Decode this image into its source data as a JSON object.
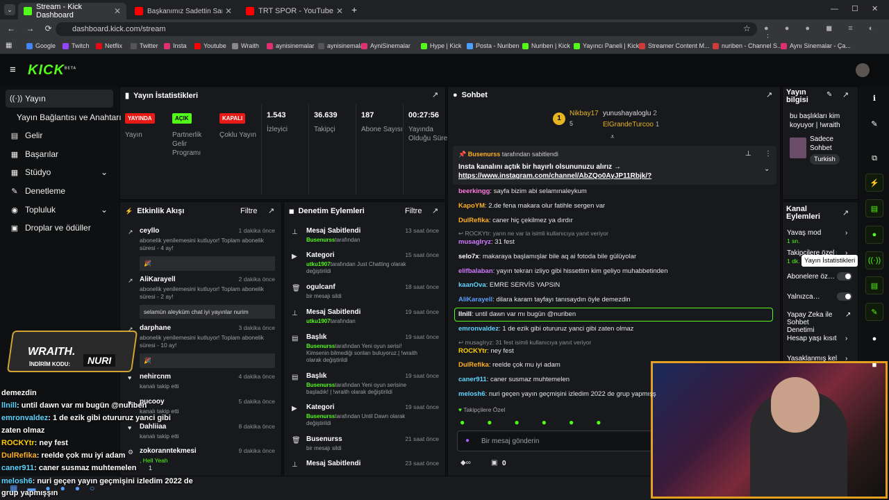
{
  "browser": {
    "tabs": [
      {
        "label": "Stream - Kick Dashboard"
      },
      {
        "label": "Başkanımız Sadettin Saran Gün…"
      },
      {
        "label": "TRT SPOR - YouTube"
      }
    ],
    "url": "dashboard.kick.com/stream",
    "bookmarks": [
      "Google",
      "Twitch",
      "Netflix",
      "Twitter",
      "Insta",
      "Youtube",
      "Wraith",
      "aynisinemalar",
      "aynisinemalar",
      "AyniSinemalar",
      "Hype | Kick",
      "Posta - Nuriben",
      "Nuriben | Kick",
      "Yayıncı Paneli | Kick",
      "Streamer Content M...",
      "nuriben - Channel S...",
      "Aynı Sinemalar - Ça..."
    ]
  },
  "header": {
    "logo": "KICK",
    "beta": "BETA"
  },
  "sidebar": {
    "items": [
      {
        "label": "Yayın",
        "icon": "broadcast-icon"
      },
      {
        "label": "Yayın Bağlantısı ve Anahtarı"
      },
      {
        "label": "Gelir",
        "icon": "revenue-icon"
      },
      {
        "label": "Başarılar",
        "icon": "achievement-icon"
      },
      {
        "label": "Stüdyo",
        "icon": "studio-icon"
      },
      {
        "label": "Denetleme",
        "icon": "wrench-icon"
      },
      {
        "label": "Topluluk",
        "icon": "community-icon"
      },
      {
        "label": "Droplar ve ödüller",
        "icon": "gift-icon"
      }
    ]
  },
  "stats": {
    "title": "Yayın İstatistikleri",
    "badges": [
      {
        "text": "YAYINDA",
        "label": "Yayın"
      },
      {
        "text": "AÇIK",
        "label": "Partnerlik Gelir Programı"
      },
      {
        "text": "KAPALI",
        "label": "Çoklu Yayın"
      }
    ],
    "values": [
      {
        "value": "1.543",
        "label": "İzleyici"
      },
      {
        "value": "36.639",
        "label": "Takipçi"
      },
      {
        "value": "187",
        "label": "Abone Sayısı"
      },
      {
        "value": "00:27:56",
        "label": "Yayında Olduğu Süre"
      }
    ]
  },
  "activity": {
    "title": "Etkinlik Akışı",
    "filter": "Filtre",
    "items": [
      {
        "name": "ceyllo",
        "time": "1 dakika önce",
        "text": "abonelik yenilemesini kutluyor! Toplam abonelik süresi - 4 ay!",
        "msg": "🎉"
      },
      {
        "name": "AliKarayell",
        "time": "2 dakika önce",
        "text": "abonelik yenilemesini kutluyor! Toplam abonelik süresi - 2 ay!",
        "msg": "selamün aleyküm chat iyi yayınlar nurim"
      },
      {
        "name": "darphane",
        "time": "3 dakika önce",
        "text": "abonelik yenilemesini kutluyor! Toplam abonelik süresi - 10 ay!",
        "msg": "🎉"
      },
      {
        "name": "nehircnm",
        "time": "4 dakika önce",
        "text": "kanalı takip etti"
      },
      {
        "name": "pucooy",
        "time": "5 dakika önce",
        "text": "kanalı takip etti"
      },
      {
        "name": "Dahliiaa",
        "time": "8 dakika önce",
        "text": "kanalı takip etti"
      },
      {
        "name": "zokoranntekmesi",
        "time": "9 dakika önce",
        "text": ", Hell Yeah",
        "count": "1"
      }
    ]
  },
  "moderation": {
    "title": "Denetim Eylemleri",
    "filter": "Filtre",
    "items": [
      {
        "title": "Mesaj Sabitlendi",
        "time": "13 saat önce",
        "user": "Busenurss",
        "rest": "tarafından"
      },
      {
        "title": "Kategori",
        "time": "15 saat önce",
        "user": "utku1907",
        "rest": "tarafından Just Chatting olarak değiştirildi"
      },
      {
        "title": "ogulcanf",
        "time": "18 saat önce",
        "user": "",
        "rest": "bir mesajı sildi"
      },
      {
        "title": "Mesaj Sabitlendi",
        "time": "19 saat önce",
        "user": "utku1907",
        "rest": "tarafından"
      },
      {
        "title": "Başlık",
        "time": "19 saat önce",
        "user": "Busenurss",
        "rest": "tarafından Yeni oyun serisi! Kimsenin bilmediği sonları buluyoruz.| !wraith olarak değiştirildi"
      },
      {
        "title": "Başlık",
        "time": "19 saat önce",
        "user": "Busenurss",
        "rest": "tarafından Yeni oyun serisine başladık! | !wraith olarak değiştirildi"
      },
      {
        "title": "Kategori",
        "time": "19 saat önce",
        "user": "Busenurss",
        "rest": "tarafından Until Dawn olarak değiştirildi"
      },
      {
        "title": "Busenurss",
        "time": "21 saat önce",
        "user": "",
        "rest": "bir mesajı sildi"
      },
      {
        "title": "Mesaj Sabitlendi",
        "time": "23 saat önce",
        "user": "",
        "rest": ""
      }
    ]
  },
  "chat": {
    "title": "Sohbet",
    "top": [
      {
        "rank": "1",
        "name": "Nikbay17",
        "count": "5"
      },
      {
        "name": "yunushayaloglu",
        "count": "2"
      },
      {
        "name": "ElGrandeTurcoo",
        "count": "1"
      }
    ],
    "pinned": {
      "by": "Busenurss",
      "by_suffix": "tarafından sabitlendi",
      "text": "Insta kanalını açtık bir hayırlı olsununuzu alırız →",
      "link": "https://www.instagram.com/channel/AbZQo0AyJP11Rbjk/?"
    },
    "messages": [
      {
        "user": "beerkingg",
        "color": "#ff7ae0",
        "text": "sayfa bizim abi selamınaleykum"
      },
      {
        "user": "KapoYM",
        "color": "#ffb020",
        "text": "2.de fena makara olur fatihle sergen var"
      },
      {
        "user": "DulRefika",
        "color": "#ffb020",
        "text": "caner hiç çekilmez ya dırdır"
      },
      {
        "user": "",
        "color": "#8b8f94",
        "text": "↩ ROCKYtr: yarın ne var la isimli kullanıcıya yanıt veriyor"
      },
      {
        "user": "musagIryz",
        "color": "#d07bff",
        "text": "31 fest"
      },
      {
        "user": "selo7x",
        "color": "#ffffff",
        "text": "makaraya başlamışlar bile aq ai fotoda bile gülüyolar"
      },
      {
        "user": "elifbalaban",
        "color": "#d07bff",
        "text": "yayın tekrarı izliyo gibi hissettim kim geliyo muhabbetinden"
      },
      {
        "user": "kaanOva",
        "color": "#5cd6ff",
        "text": "EMRE SERVİS YAPSIN"
      },
      {
        "user": "AliKarayell",
        "color": "#5aa0ff",
        "text": "dilara karam tayfayı tanısaydın öyle demezdin"
      },
      {
        "user": "llnill",
        "color": "#ffffff",
        "text": "until dawn var mı bugün @nuriben"
      },
      {
        "user": "emronvaldez",
        "color": "#5cd6ff",
        "text": "1 de ezik gibi otururuz yanci gibi zaten olmaz"
      },
      {
        "user": "",
        "color": "#8b8f94",
        "text": "↩ musagIryz: 31 fest isimli kullanıcıya yanıt veriyor"
      },
      {
        "user": "ROCKYtr",
        "color": "#ffd000",
        "text": "ney fest"
      },
      {
        "user": "DulRefika",
        "color": "#ffb020",
        "text": "reelde çok mu iyi adam"
      },
      {
        "user": "caner911",
        "color": "#5cd6ff",
        "text": "caner susmaz muhtemelen"
      },
      {
        "user": "melosh6",
        "color": "#5cd6ff",
        "text": "nuri geçen yayın geçmişini izledim 2022 de grup yapmışş"
      }
    ],
    "followers_only": "Takipçilere Özel",
    "input_placeholder": "Bir mesaj gönderin",
    "footer_count": "0"
  },
  "info": {
    "title": "Yayın bilgisi",
    "stream_title": "bu başlıkları kim koyuyor | !wraith",
    "category": "Sadece Sohbet",
    "language": "Turkish"
  },
  "channel_actions": {
    "title": "Kanal Eylemleri",
    "items": [
      {
        "label": "Yavaş mod",
        "sub": "1 sn."
      },
      {
        "label": "Takipçilere özel s…",
        "sub": "1 dk."
      },
      {
        "label": "Abonelere öz…"
      },
      {
        "label": "Yalnızca…"
      },
      {
        "label": "Yapay Zeka ile Sohbet Denetimi"
      },
      {
        "label": "Hesap yaşı kısıtla"
      },
      {
        "label": "Yasaklanmış kelin…"
      }
    ]
  },
  "tooltip": "Yayın İstatistikleri",
  "overlay": {
    "sponsor_brand": "WRAITH.",
    "sponsor_code_label": "İNDİRİM KODU:",
    "sponsor_code": "NURI",
    "lines": [
      {
        "user": "",
        "text": "demezdin"
      },
      {
        "user": "llnill",
        "text": ": until dawn var mı bugün @nuriben"
      },
      {
        "user": "emronvaldez",
        "text": ": 1 de ezik gibi otururuz yanci gibi"
      },
      {
        "user": "",
        "text": "zaten olmaz"
      },
      {
        "user": "ROCKYtr",
        "text": ": ney fest"
      },
      {
        "user": "DulRefika",
        "text": ": reelde çok mu iyi adam"
      },
      {
        "user": "caner911",
        "text": ": caner susmaz muhtemelen"
      },
      {
        "user": "melosh6",
        "text": ": nuri geçen yayın geçmişini izledim 2022 de"
      },
      {
        "user": "",
        "text": "grup yapmışşın"
      }
    ]
  },
  "colors": {
    "accent": "#53fc18",
    "live": "#e91916",
    "panel": "#18191c",
    "bg": "#0f1012"
  }
}
